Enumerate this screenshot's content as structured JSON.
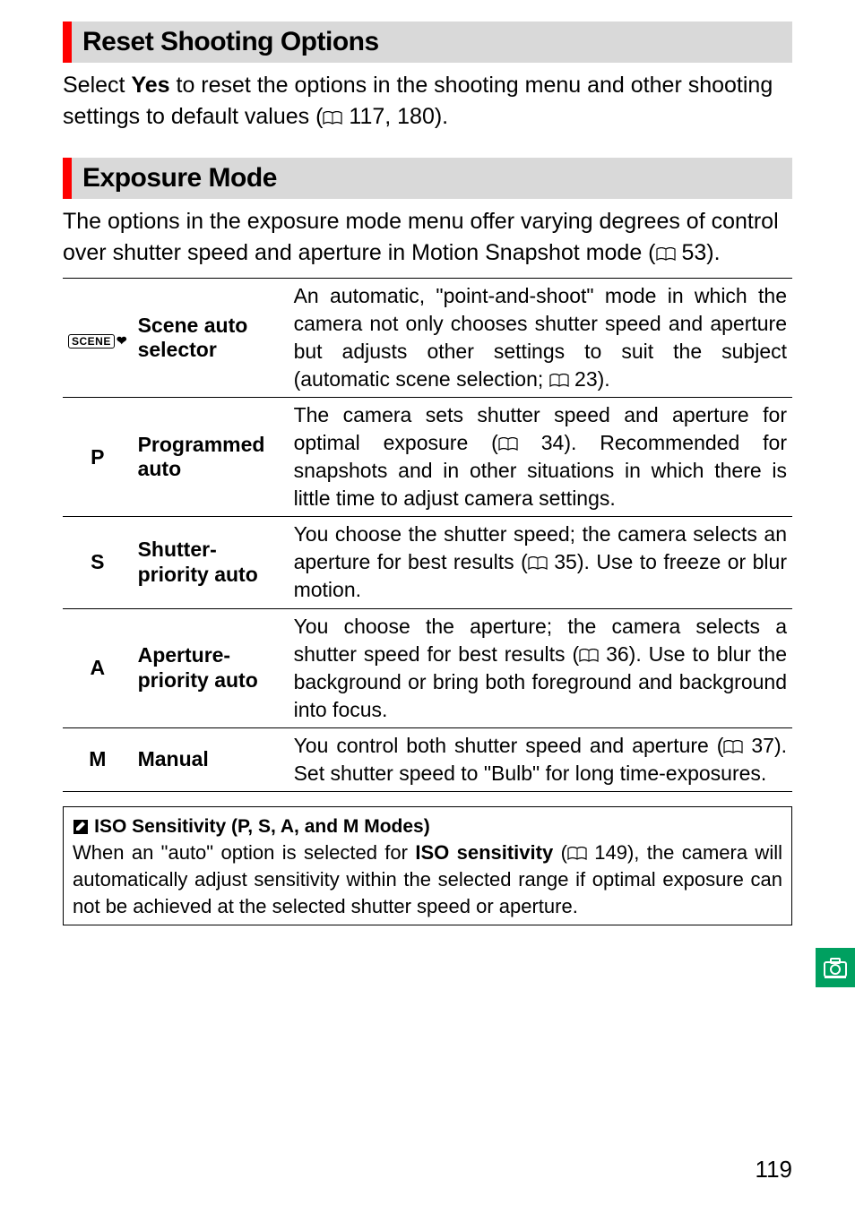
{
  "sections": {
    "reset": {
      "heading": "Reset Shooting Options",
      "body_pre": "Select ",
      "body_yes": "Yes",
      "body_mid": " to reset the options in the shooting menu and other shooting settings to default values (",
      "body_ref": " 117, 180)."
    },
    "exposure": {
      "heading": "Exposure Mode",
      "body_pre": "The options in the exposure mode menu offer varying degrees of control over shutter speed and aperture in Motion Snapshot mode (",
      "body_ref": " 53)."
    }
  },
  "table": [
    {
      "code_type": "scene",
      "label": "Scene auto selector",
      "desc_pre": "An automatic, \"point-and-shoot\" mode in which the camera not only chooses shutter speed and aperture but adjusts other settings to suit the subject (automatic scene selection; ",
      "desc_ref": " 23)."
    },
    {
      "code": "P",
      "label": "Programmed auto",
      "desc_pre": "The camera sets shutter speed and aperture for optimal exposure (",
      "desc_ref": " 34).  Recommended for snapshots and in other situations in which there is little time to adjust camera settings."
    },
    {
      "code": "S",
      "label": "Shutter-priority auto",
      "desc_pre": "You choose the shutter speed; the camera selects an aperture for best results (",
      "desc_ref": " 35).  Use to freeze or blur motion."
    },
    {
      "code": "A",
      "label": "Aperture-priority auto",
      "desc_pre": "You choose the aperture; the camera selects a shutter speed for best results (",
      "desc_ref": " 36).  Use to blur the background or bring both foreground and background into focus."
    },
    {
      "code": "M",
      "label": "Manual",
      "desc_pre": "You control both shutter speed and aperture (",
      "desc_ref": " 37). Set shutter speed to \"Bulb\" for long time-exposures."
    }
  ],
  "note": {
    "title": "ISO Sensitivity (P, S, A, and M Modes)",
    "body_pre": "When an \"auto\" option is selected for ",
    "body_bold": "ISO sensitivity",
    "body_mid": " (",
    "body_ref": " 149), the camera will automatically adjust sensitivity within the selected range if optimal exposure can not be achieved at the selected shutter speed or aperture."
  },
  "page_number": "119"
}
